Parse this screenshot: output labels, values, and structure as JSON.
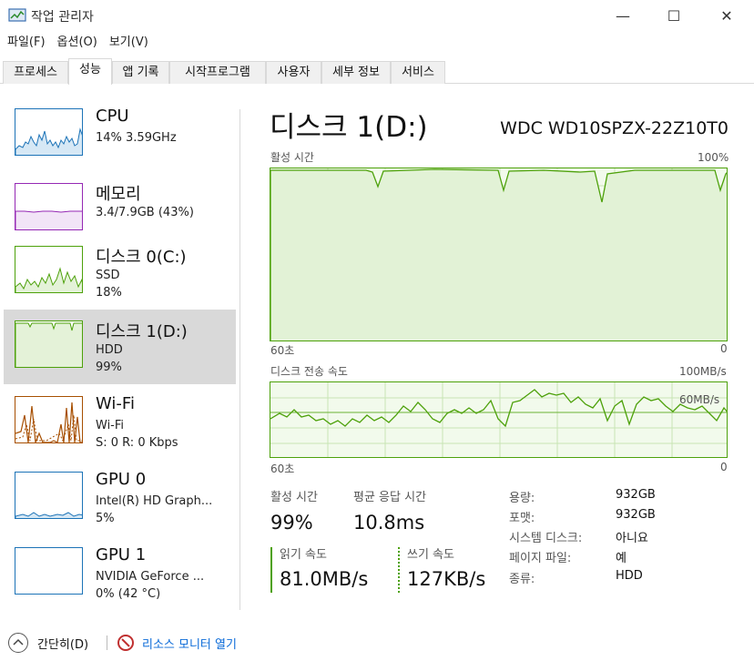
{
  "window": {
    "title": "작업 관리자",
    "icon": "task-manager-icon",
    "minimize": "—",
    "maximize": "☐",
    "close": "✕"
  },
  "menu": [
    "파일(F)",
    "옵션(O)",
    "보기(V)"
  ],
  "tabs": [
    "프로세스",
    "성능",
    "앱 기록",
    "시작프로그램",
    "사용자",
    "세부 정보",
    "서비스"
  ],
  "active_tab": "성능",
  "resources": [
    {
      "name": "CPU",
      "sub1": "14%  3.59GHz",
      "sub2": "",
      "color": "#1c73b7",
      "selected": false,
      "usage": 0.14
    },
    {
      "name": "메모리",
      "sub1": "3.4/7.9GB (43%)",
      "sub2": "",
      "color": "#9528b4",
      "selected": false,
      "usage": 0.43
    },
    {
      "name": "디스크 0(C:)",
      "sub1": "SSD",
      "sub2": "18%",
      "color": "#4da10a",
      "selected": false,
      "usage": 0.18
    },
    {
      "name": "디스크 1(D:)",
      "sub1": "HDD",
      "sub2": "99%",
      "color": "#4da10a",
      "selected": true,
      "usage": 0.99
    },
    {
      "name": "Wi-Fi",
      "sub1": "Wi-Fi",
      "sub2": "S: 0  R: 0 Kbps",
      "color": "#a74f01",
      "selected": false,
      "usage": 0.0
    },
    {
      "name": "GPU 0",
      "sub1": "Intel(R) HD Graph...",
      "sub2": "5%",
      "color": "#1c73b7",
      "selected": false,
      "usage": 0.05
    },
    {
      "name": "GPU 1",
      "sub1": "NVIDIA GeForce ...",
      "sub2": "0% (42 °C)",
      "color": "#1c73b7",
      "selected": false,
      "usage": 0.0
    }
  ],
  "detail": {
    "title": "디스크 1(D:)",
    "model": "WDC WD10SPZX-22Z10T0",
    "graph1": {
      "label": "활성 시간",
      "max": "100%",
      "time_left": "60초",
      "time_right": "0"
    },
    "graph2": {
      "label": "디스크 전송 속도",
      "max": "100MB/s",
      "line_label": "60MB/s",
      "time_left": "60초",
      "time_right": "0"
    },
    "stats": {
      "active_time_label": "활성 시간",
      "active_time_value": "99%",
      "response_label": "평균 응답 시간",
      "response_value": "10.8ms",
      "read_label": "읽기 속도",
      "read_value": "81.0MB/s",
      "write_label": "쓰기 속도",
      "write_value": "127KB/s"
    },
    "properties": [
      {
        "key": "용량:",
        "value": "932GB"
      },
      {
        "key": "포맷:",
        "value": "932GB"
      },
      {
        "key": "시스템 디스크:",
        "value": "아니요"
      },
      {
        "key": "페이지 파일:",
        "value": "예"
      },
      {
        "key": "종류:",
        "value": "HDD"
      }
    ]
  },
  "footer": {
    "fewer_details": "간단히(D)",
    "resource_monitor": "리소스 모니터 열기"
  }
}
